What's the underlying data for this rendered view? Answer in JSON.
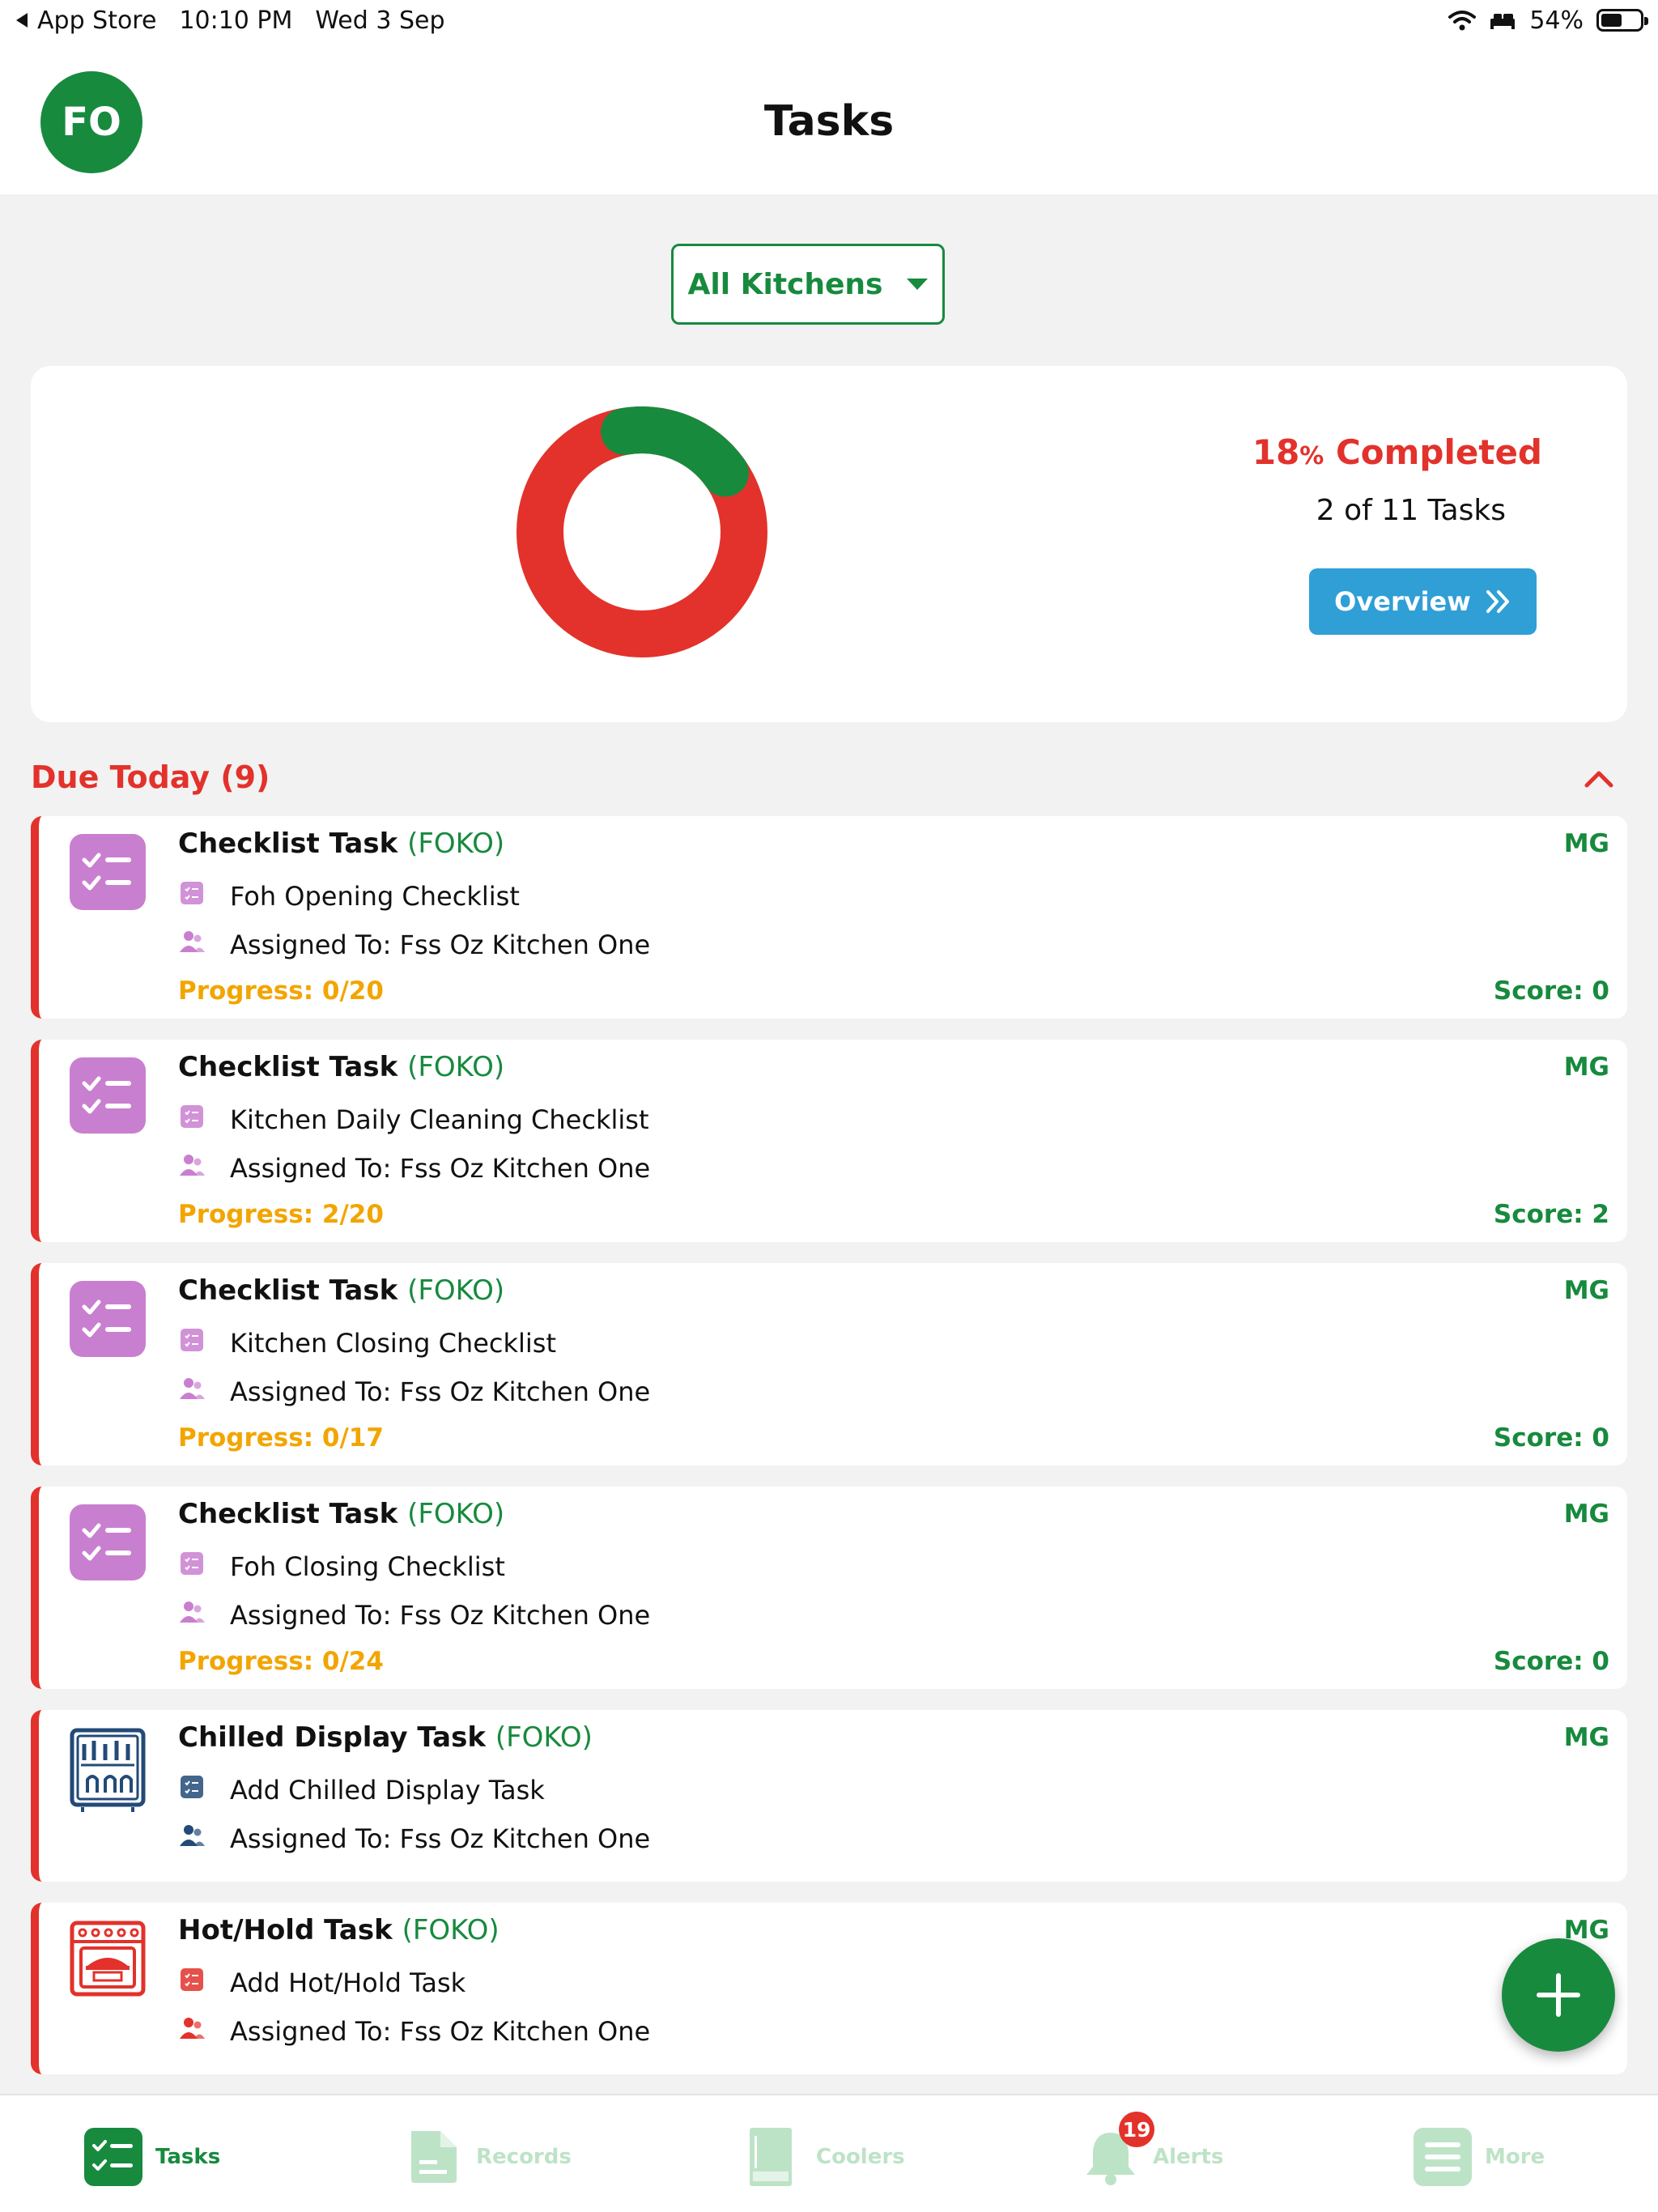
{
  "status_bar": {
    "back_app": "App Store",
    "time": "10:10 PM",
    "date": "Wed 3 Sep",
    "battery": "54%",
    "battery_level": 0.54
  },
  "header": {
    "avatar_initials": "FO",
    "title": "Tasks"
  },
  "filter": {
    "selected": "All Kitchens"
  },
  "summary": {
    "percent_value": "18",
    "percent_sign": "%",
    "completed_label": "Completed",
    "tasks_count_text": "2 of 11 Tasks",
    "completed_fraction": 0.18,
    "overview_button": "Overview",
    "colors": {
      "completed": "#178a3e",
      "remaining": "#e2322b"
    }
  },
  "section": {
    "title": "Due Today (9)"
  },
  "tasks": [
    {
      "type": "Checklist Task",
      "org": "(FOKO)",
      "assignee_badge": "MG",
      "name": "Foh Opening Checklist",
      "assigned": "Assigned To: Fss Oz Kitchen One",
      "progress": "Progress: 0/20",
      "score": "Score: 0",
      "icon": "checklist-icon",
      "color": "#c97fd0"
    },
    {
      "type": "Checklist Task",
      "org": "(FOKO)",
      "assignee_badge": "MG",
      "name": "Kitchen Daily Cleaning Checklist",
      "assigned": "Assigned To: Fss Oz Kitchen One",
      "progress": "Progress: 2/20",
      "score": "Score: 2",
      "icon": "checklist-icon",
      "color": "#c97fd0"
    },
    {
      "type": "Checklist Task",
      "org": "(FOKO)",
      "assignee_badge": "MG",
      "name": "Kitchen Closing Checklist",
      "assigned": "Assigned To: Fss Oz Kitchen One",
      "progress": "Progress: 0/17",
      "score": "Score: 0",
      "icon": "checklist-icon",
      "color": "#c97fd0"
    },
    {
      "type": "Checklist Task",
      "org": "(FOKO)",
      "assignee_badge": "MG",
      "name": "Foh Closing Checklist",
      "assigned": "Assigned To: Fss Oz Kitchen One",
      "progress": "Progress: 0/24",
      "score": "Score: 0",
      "icon": "checklist-icon",
      "color": "#c97fd0"
    },
    {
      "type": "Chilled Display Task",
      "org": "(FOKO)",
      "assignee_badge": "MG",
      "name": "Add Chilled Display Task",
      "assigned": "Assigned To: Fss Oz Kitchen One",
      "icon": "chilled-display-icon",
      "color": "#234a78"
    },
    {
      "type": "Hot/Hold Task",
      "org": "(FOKO)",
      "assignee_badge": "MG",
      "name": "Add Hot/Hold Task",
      "assigned": "Assigned To: Fss Oz Kitchen One",
      "icon": "hot-hold-icon",
      "color": "#e2322b"
    }
  ],
  "bottom_nav": {
    "items": [
      {
        "label": "Tasks",
        "icon": "tasks-icon",
        "active": true
      },
      {
        "label": "Records",
        "icon": "records-icon",
        "active": false
      },
      {
        "label": "Coolers",
        "icon": "coolers-icon",
        "active": false
      },
      {
        "label": "Alerts",
        "icon": "alerts-icon",
        "active": false
      },
      {
        "label": "More",
        "icon": "more-icon",
        "active": false
      }
    ],
    "alerts_badge": "19"
  }
}
